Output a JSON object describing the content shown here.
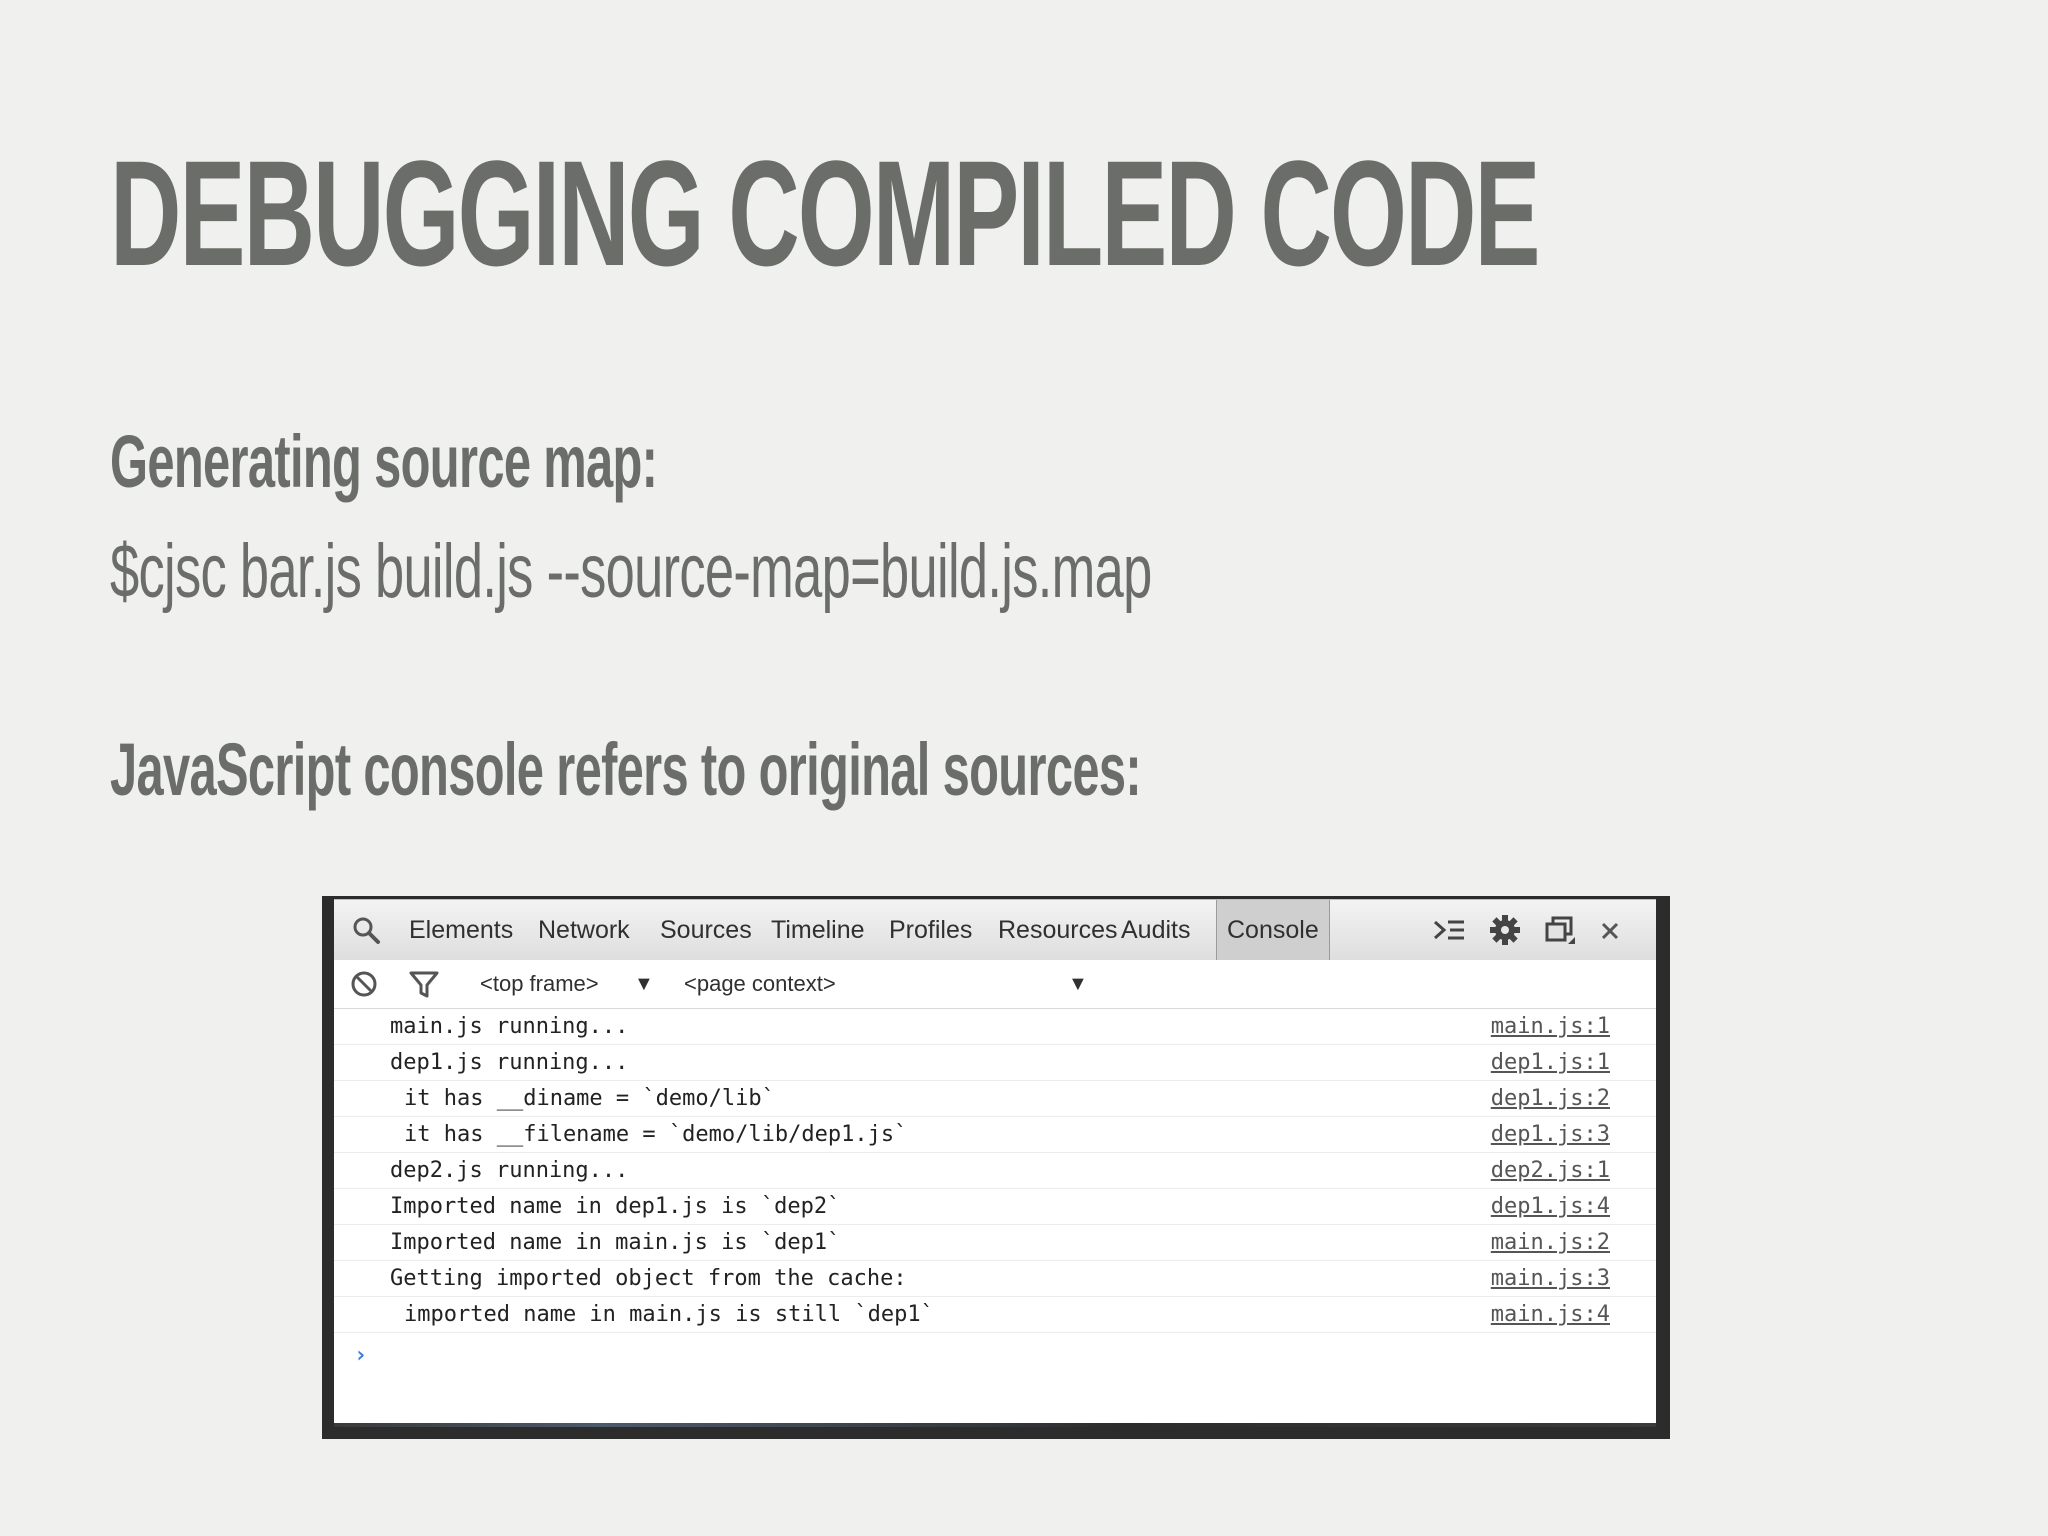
{
  "slide": {
    "title": "DEBUGGING COMPILED CODE",
    "heading1": "Generating source map:",
    "command": "$cjsc bar.js build.js --source-map=build.js.map",
    "heading2": "JavaScript console refers to original sources:"
  },
  "devtools": {
    "tabs": [
      {
        "label": "Elements",
        "active": false
      },
      {
        "label": "Network",
        "active": false
      },
      {
        "label": "Sources",
        "active": false
      },
      {
        "label": "Timeline",
        "active": false
      },
      {
        "label": "Profiles",
        "active": false
      },
      {
        "label": "Resources",
        "active": false
      },
      {
        "label": "Audits",
        "active": false
      },
      {
        "label": "Console",
        "active": true
      }
    ],
    "icons": {
      "search": "search-icon",
      "drawer": "show-drawer-icon",
      "settings": "gear-icon",
      "dock": "dock-icon",
      "close": "close-icon",
      "clear": "clear-console-icon",
      "filter": "filter-icon"
    },
    "filterbar": {
      "frame": "<top frame>",
      "context": "<page context>"
    },
    "log": [
      {
        "msg": "main.js running...",
        "src": "main.js:1",
        "indent": false
      },
      {
        "msg": "dep1.js running...",
        "src": "dep1.js:1",
        "indent": false
      },
      {
        "msg": "it has __diname = `demo/lib`",
        "src": "dep1.js:2",
        "indent": true
      },
      {
        "msg": "it has __filename = `demo/lib/dep1.js`",
        "src": "dep1.js:3",
        "indent": true
      },
      {
        "msg": "dep2.js running...",
        "src": "dep2.js:1",
        "indent": false
      },
      {
        "msg": "Imported name in dep1.js is `dep2`",
        "src": "dep1.js:4",
        "indent": false
      },
      {
        "msg": "Imported name in main.js is `dep1`",
        "src": "main.js:2",
        "indent": false
      },
      {
        "msg": "Getting imported object from the cache:",
        "src": "main.js:3",
        "indent": false
      },
      {
        "msg": "imported name in main.js is still `dep1`",
        "src": "main.js:4",
        "indent": true
      }
    ],
    "prompt": "›"
  }
}
